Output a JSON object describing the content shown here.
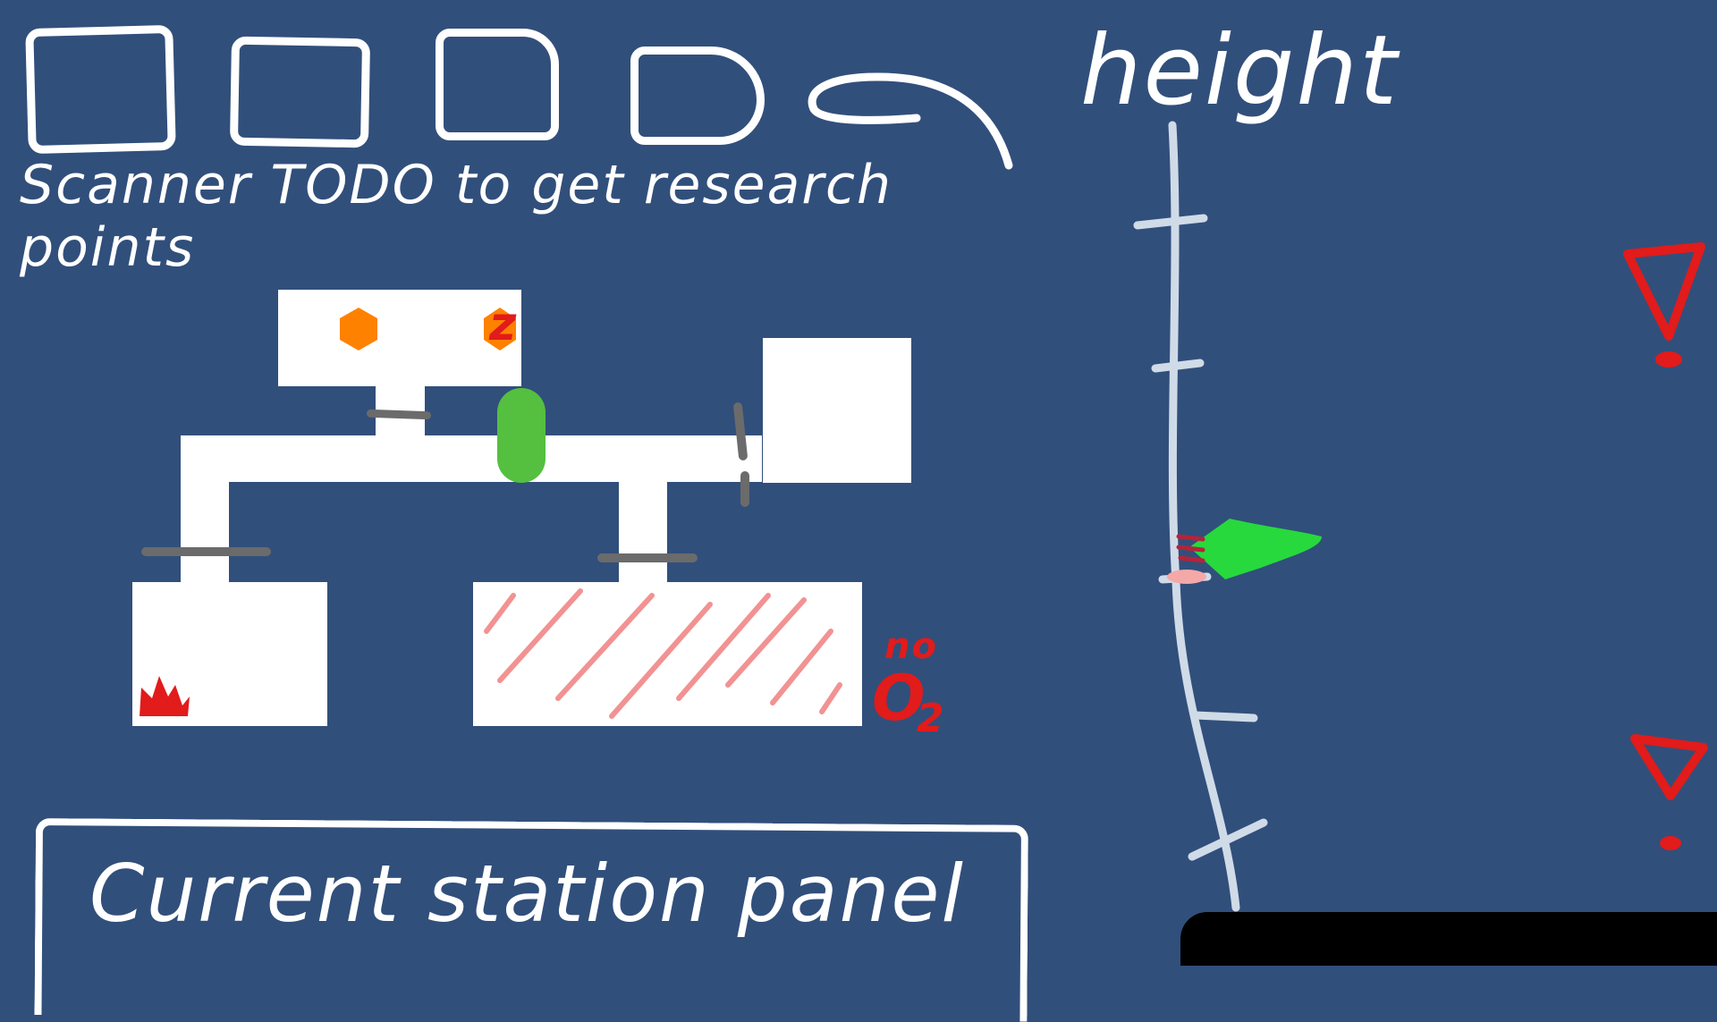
{
  "toolbar": {
    "slots": [
      {
        "id": "slot-1"
      },
      {
        "id": "slot-2"
      },
      {
        "id": "slot-3"
      },
      {
        "id": "slot-4"
      }
    ],
    "note": "Scanner TODO to get research points"
  },
  "station": {
    "rooms": [
      "top-room",
      "right-room",
      "left-room",
      "bottom-room"
    ],
    "bottom_room_status": {
      "no": "no",
      "o2": "O",
      "sub": "2"
    }
  },
  "height_gauge": {
    "label": "height"
  },
  "panel": {
    "label": "Current station panel"
  },
  "colors": {
    "background": "#314f7b",
    "warning": "#e21b1b",
    "player": "#55bf40",
    "hazard": "#ff8100",
    "door": "#6b6b6b"
  }
}
